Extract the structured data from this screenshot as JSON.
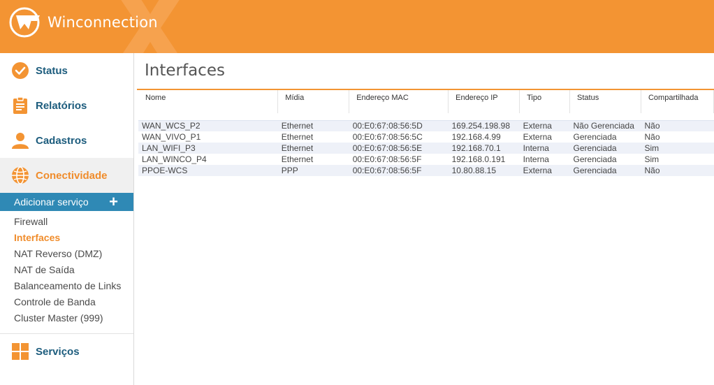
{
  "app": {
    "brand": "Winconnection",
    "accent": "#f39433",
    "link_color": "#1c5c7d",
    "menu_blue": "#2f89b5"
  },
  "nav": {
    "items": [
      {
        "label": "Status",
        "icon": "check-circle-icon"
      },
      {
        "label": "Relatórios",
        "icon": "clipboard-icon"
      },
      {
        "label": "Cadastros",
        "icon": "user-icon"
      },
      {
        "label": "Conectividade",
        "icon": "globe-icon",
        "active": true
      }
    ],
    "add_service": {
      "label": "Adicionar serviço",
      "icon": "plus-icon"
    },
    "subitems": [
      {
        "label": "Firewall"
      },
      {
        "label": "Interfaces",
        "active": true
      },
      {
        "label": "NAT Reverso (DMZ)"
      },
      {
        "label": "NAT de Saída"
      },
      {
        "label": "Balanceamento de Links"
      },
      {
        "label": "Controle de Banda"
      },
      {
        "label": "Cluster Master (999)"
      }
    ],
    "bottom_item": {
      "label": "Serviços",
      "icon": "grid-icon"
    }
  },
  "main": {
    "title": "Interfaces",
    "columns": [
      "Nome",
      "Mídia",
      "Endereço MAC",
      "Endereço IP",
      "Tipo",
      "Status",
      "Compartilhada"
    ],
    "rows": [
      [
        "WAN_WCS_P2",
        "Ethernet",
        "00:E0:67:08:56:5D",
        "169.254.198.98",
        "Externa",
        "Não Gerenciada",
        "Não"
      ],
      [
        "WAN_VIVO_P1",
        "Ethernet",
        "00:E0:67:08:56:5C",
        "192.168.4.99",
        "Externa",
        "Gerenciada",
        "Não"
      ],
      [
        "LAN_WIFI_P3",
        "Ethernet",
        "00:E0:67:08:56:5E",
        "192.168.70.1",
        "Interna",
        "Gerenciada",
        "Sim"
      ],
      [
        "LAN_WINCO_P4",
        "Ethernet",
        "00:E0:67:08:56:5F",
        "192.168.0.191",
        "Interna",
        "Gerenciada",
        "Sim"
      ],
      [
        "PPOE-WCS",
        "PPP",
        "00:E0:67:08:56:5F",
        "10.80.88.15",
        "Externa",
        "Gerenciada",
        "Não"
      ]
    ]
  }
}
